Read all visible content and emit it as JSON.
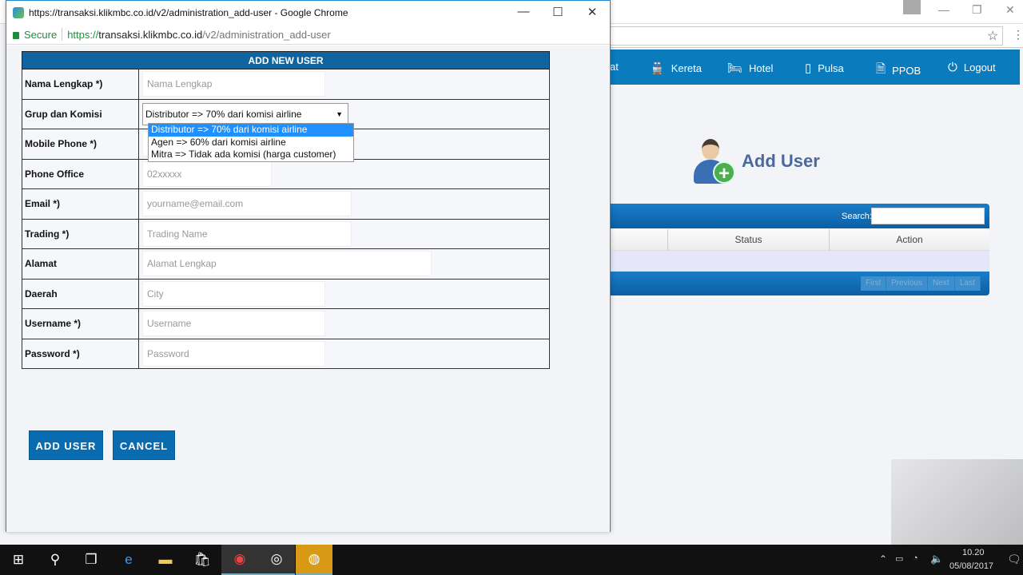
{
  "background_page": {
    "nav": [
      {
        "label": "at",
        "icon": "truncated"
      },
      {
        "label": "Kereta",
        "icon": "train-icon"
      },
      {
        "label": "Hotel",
        "icon": "bed-icon"
      },
      {
        "label": "Pulsa",
        "icon": "phone-icon"
      },
      {
        "label": "PPOB",
        "icon": "document-icon"
      },
      {
        "label": "Logout",
        "icon": "power-icon"
      }
    ],
    "title": "Add User",
    "search_label": "Search:",
    "columns": [
      "Status",
      "Action"
    ],
    "pagination": [
      "First",
      "Previous",
      "Next",
      "Last"
    ],
    "nav_color": "#0a7bbd"
  },
  "popup": {
    "window_title": "https://transaksi.klikmbc.co.id/v2/administration_add-user - Google Chrome",
    "secure_label": "Secure",
    "url_scheme": "https://",
    "url_host": "transaksi.klikmbc.co.id",
    "url_path": "/v2/administration_add-user",
    "form": {
      "header": "ADD NEW USER",
      "fields": [
        {
          "label": "Nama Lengkap *)",
          "placeholder": "Nama Lengkap"
        },
        {
          "label": "Grup dan Komisi",
          "value": "Distributor => 70% dari komisi airline"
        },
        {
          "label": "Mobile Phone *)",
          "placeholder": ""
        },
        {
          "label": "Phone Office",
          "placeholder": "02xxxxx"
        },
        {
          "label": "Email *)",
          "placeholder": "yourname@email.com"
        },
        {
          "label": "Trading *)",
          "placeholder": "Trading Name"
        },
        {
          "label": "Alamat",
          "placeholder": "Alamat Lengkap"
        },
        {
          "label": "Daerah",
          "placeholder": "City"
        },
        {
          "label": "Username *)",
          "placeholder": "Username"
        },
        {
          "label": "Password *)",
          "placeholder": "Password"
        }
      ],
      "dropdown_options": [
        "Distributor => 70% dari komisi airline",
        "Agen => 60% dari komisi airline",
        "Mitra => Tidak ada komisi (harga customer)"
      ],
      "selected_option": 0
    },
    "add_button": "ADD USER",
    "cancel_button": "CANCEL",
    "accent": "#0a6cb0"
  },
  "taskbar": {
    "time": "10.20",
    "date": "05/08/2017"
  }
}
